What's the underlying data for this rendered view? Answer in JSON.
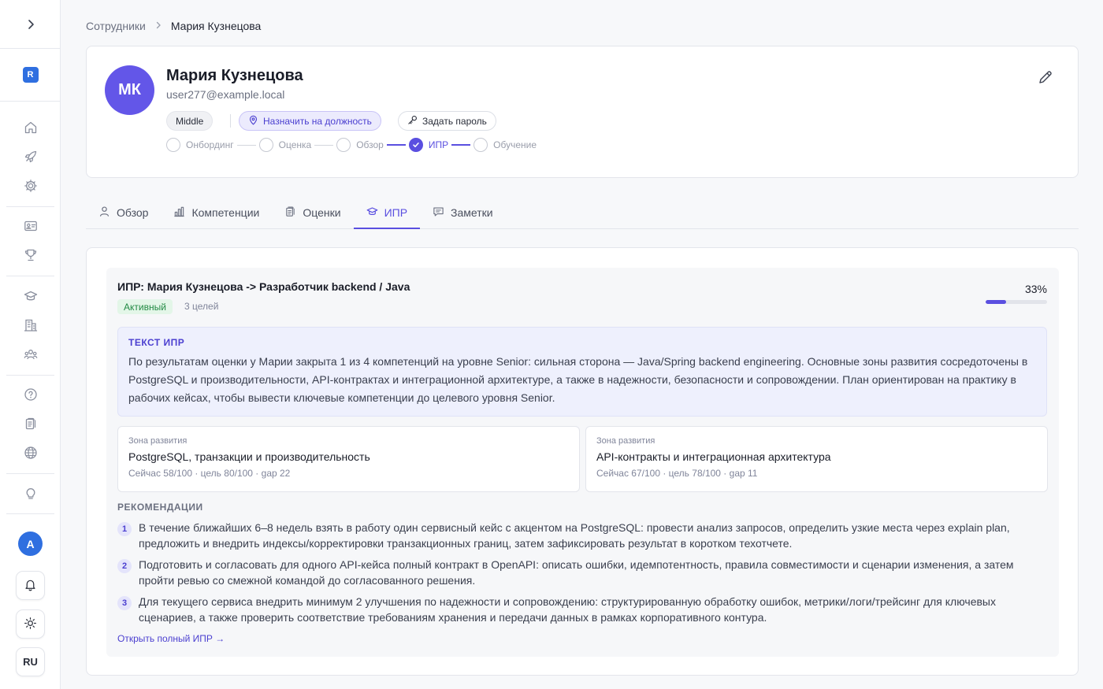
{
  "sidebar": {
    "toggle_icon": "chevron-right-icon",
    "logo_letter": "R",
    "icons": [
      "home-icon",
      "rocket-icon",
      "gear-icon",
      "id-card-icon",
      "trophy-icon",
      "graduation-cap-icon",
      "building-icon",
      "team-icon",
      "help-icon",
      "clipboard-icon",
      "globe-icon",
      "lightbulb-icon"
    ],
    "user_initial": "A",
    "notifications_icon": "bell-icon",
    "theme_icon": "sun-icon",
    "language": "RU"
  },
  "breadcrumb": {
    "parent": "Сотрудники",
    "current": "Мария Кузнецова"
  },
  "profile": {
    "initials": "МК",
    "name": "Мария Кузнецова",
    "email": "user277@example.local",
    "level": "Middle",
    "assign_label": "Назначить на должность",
    "set_password_label": "Задать пароль",
    "steps": [
      {
        "label": "Онбординг",
        "state": "pending"
      },
      {
        "label": "Оценка",
        "state": "pending"
      },
      {
        "label": "Обзор",
        "state": "pending"
      },
      {
        "label": "ИПР",
        "state": "active"
      },
      {
        "label": "Обучение",
        "state": "pending"
      }
    ]
  },
  "tabs": [
    {
      "label": "Обзор",
      "icon": "user-icon"
    },
    {
      "label": "Компетенции",
      "icon": "bar-chart-icon"
    },
    {
      "label": "Оценки",
      "icon": "clipboard-icon"
    },
    {
      "label": "ИПР",
      "icon": "graduation-cap-icon",
      "active": true
    },
    {
      "label": "Заметки",
      "icon": "comment-icon"
    }
  ],
  "ipr": {
    "title": "ИПР: Мария Кузнецова -> Разработчик backend / Java",
    "status": "Активный",
    "goals": "3 целей",
    "progress_text": "33%",
    "progress": 0.33,
    "text_label": "ТЕКСТ ИПР",
    "text": "По результатам оценки у Марии закрыта 1 из 4 компетенций на уровне Senior: сильная сторона — Java/Spring backend engineering. Основные зоны развития сосредоточены в PostgreSQL и производительности, API-контрактах и интеграционной архитектуре, а также в надежности, безопасности и сопровождении. План ориентирован на практику в рабочих кейсах, чтобы вывести ключевые компетенции до целевого уровня Senior.",
    "zones": [
      {
        "label": "Зона развития",
        "title": "PostgreSQL, транзакции и производительность",
        "meta": "Сейчас 58/100 · цель 80/100 · gap 22"
      },
      {
        "label": "Зона развития",
        "title": "API-контракты и интеграционная архитектура",
        "meta": "Сейчас 67/100 · цель 78/100 · gap 11"
      }
    ],
    "rec_label": "РЕКОМЕНДАЦИИ",
    "recommendations": [
      {
        "num": "1",
        "text": "В течение ближайших 6–8 недель взять в работу один сервисный кейс с акцентом на PostgreSQL: провести анализ запросов, определить узкие места через explain plan, предложить и внедрить индексы/корректировки транзакционных границ, затем зафиксировать результат в коротком техотчете."
      },
      {
        "num": "2",
        "text": "Подготовить и согласовать для одного API-кейса полный контракт в OpenAPI: описать ошибки, идемпотентность, правила совместимости и сценарии изменения, а затем пройти ревью со смежной командой до согласованного решения."
      },
      {
        "num": "3",
        "text": "Для текущего сервиса внедрить минимум 2 улучшения по надежности и сопровождению: структурированную обработку ошибок, метрики/логи/трейсинг для ключевых сценариев, а также проверить соответствие требованиям хранения и передачи данных в рамках корпоративного контура."
      }
    ],
    "open_link": "Открыть полный ИПР →"
  }
}
